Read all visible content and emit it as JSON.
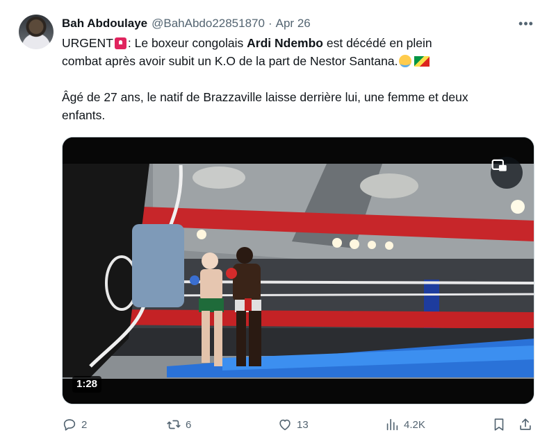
{
  "tweet": {
    "author_name": "Bah Abdoulaye",
    "author_handle": "@BahAbdo22851870",
    "separator": "·",
    "date": "Apr 26",
    "text": {
      "urgent": "URGENT",
      "line1_after_emoji": ": Le  boxeur congolais ",
      "bold_name": "Ardi Ndembo",
      "line1_end": " est décédé en plein",
      "line2": "combat après avoir subit un K.O de la part de Nestor Santana.",
      "line3": "Âgé de 27 ans, le natif de Brazzaville laisse derrière lui, une femme et deux",
      "line4": "enfants."
    },
    "emojis": [
      "rotating-light-emoji",
      "loudly-crying-face-emoji",
      "congo-flag-emoji"
    ],
    "media": {
      "duration": "1:28",
      "type": "video"
    },
    "actions": {
      "replies": "2",
      "reposts": "6",
      "likes": "13",
      "views": "4.2K"
    },
    "icons": {
      "more": "more-horizontal-icon",
      "pip": "picture-in-picture-icon",
      "reply": "reply-icon",
      "repost": "repost-icon",
      "like": "heart-icon",
      "views": "views-icon",
      "bookmark": "bookmark-icon",
      "share": "share-icon"
    },
    "colors": {
      "text": "#0f1419",
      "secondary": "#536471",
      "media_bg": "#070707"
    }
  }
}
